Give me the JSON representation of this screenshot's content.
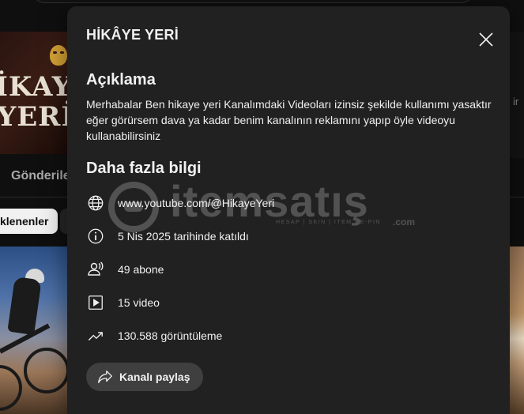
{
  "background": {
    "banner_line1": "İKAYE",
    "banner_line2": "YERİ",
    "right_text": "ir",
    "tab_label": "Gönderiler",
    "chip_label": "klenenler"
  },
  "modal": {
    "title": "HİKÂYE YERİ",
    "description_heading": "Açıklama",
    "description": "Merhabalar Ben hikaye yeri Kanalımdaki Videoları izinsiz şekilde kullanımı yasaktır eğer görürsem dava ya kadar benim kanalının reklamını yapıp öyle videoyu kullanabilirsiniz",
    "more_info_heading": "Daha fazla bilgi",
    "info": {
      "url": "www.youtube.com/@HikayeYeri",
      "joined": "5 Nis 2025 tarihinde katıldı",
      "subscribers": "49 abone",
      "videos": "15 video",
      "views": "130.588 görüntüleme"
    },
    "share_label": "Kanalı paylaş"
  },
  "watermark": {
    "word": "itemsatış",
    "sub": "HESAP | SKIN | ITEM | E-PIN",
    "com": ".com"
  }
}
